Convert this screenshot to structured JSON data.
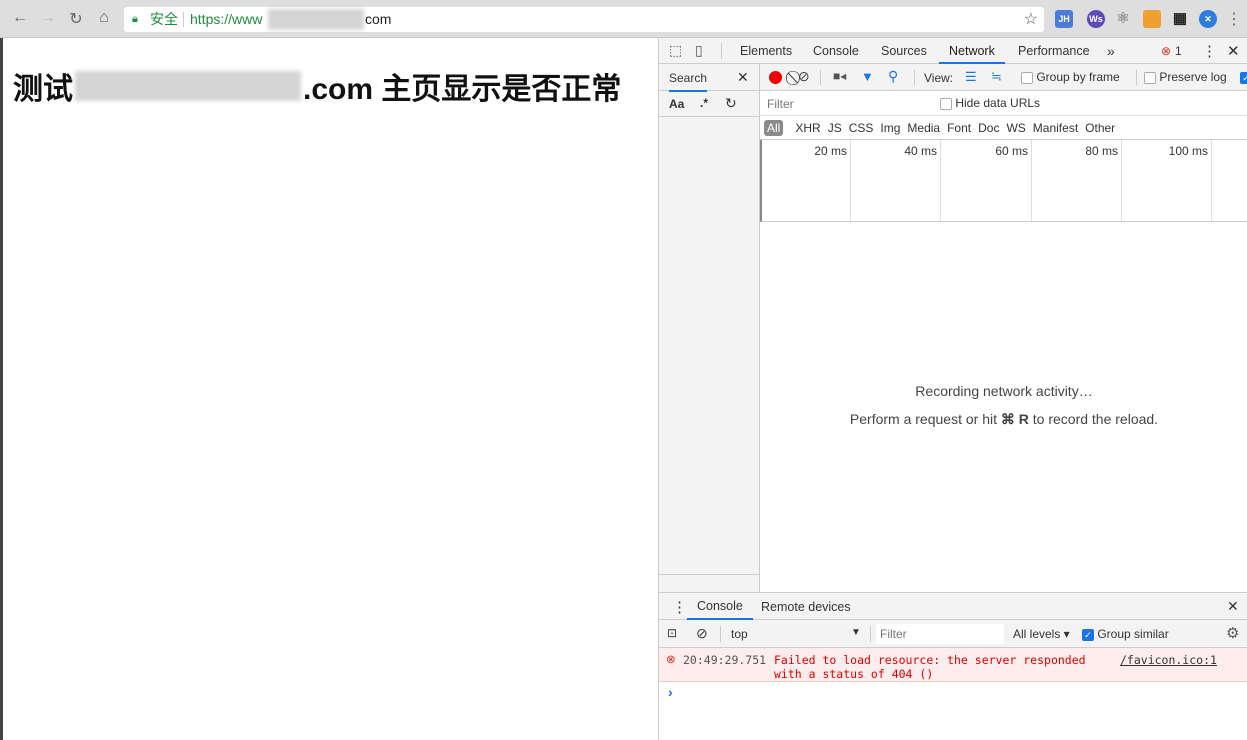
{
  "browser": {
    "security_label": "安全",
    "url_prefix": "https://www",
    "url_suffix": "com",
    "extensions": [
      "JH",
      "Ws"
    ]
  },
  "page": {
    "heading_prefix": "测试",
    "heading_suffix": ".com 主页显示是否正常"
  },
  "devtools": {
    "tabs": [
      "Elements",
      "Console",
      "Sources",
      "Network",
      "Performance"
    ],
    "more": "»",
    "error_count": "1",
    "search": {
      "title": "Search",
      "case": "Aa",
      "regex": ".*"
    },
    "network": {
      "view_label": "View:",
      "group_by_frame": "Group by frame",
      "preserve_log": "Preserve log",
      "filter_placeholder": "Filter",
      "hide_data_urls": "Hide data URLs",
      "types": [
        "All",
        "XHR",
        "JS",
        "CSS",
        "Img",
        "Media",
        "Font",
        "Doc",
        "WS",
        "Manifest",
        "Other"
      ],
      "ticks": [
        "20 ms",
        "40 ms",
        "60 ms",
        "80 ms",
        "100 ms"
      ],
      "empty_title": "Recording network activity…",
      "empty_hint_a": "Perform a request or hit",
      "empty_hint_key": "⌘ R",
      "empty_hint_b": "to record the reload."
    },
    "drawer": {
      "tabs": [
        "Console",
        "Remote devices"
      ],
      "context": "top",
      "filter_placeholder": "Filter",
      "levels": "All levels ▾",
      "group_similar": "Group similar",
      "error": {
        "time": "20:49:29.751",
        "line1": "Failed to load resource: the server responded",
        "line2": "with a status of 404 ()",
        "source": "/favicon.ico:1"
      },
      "prompt": "›"
    }
  }
}
